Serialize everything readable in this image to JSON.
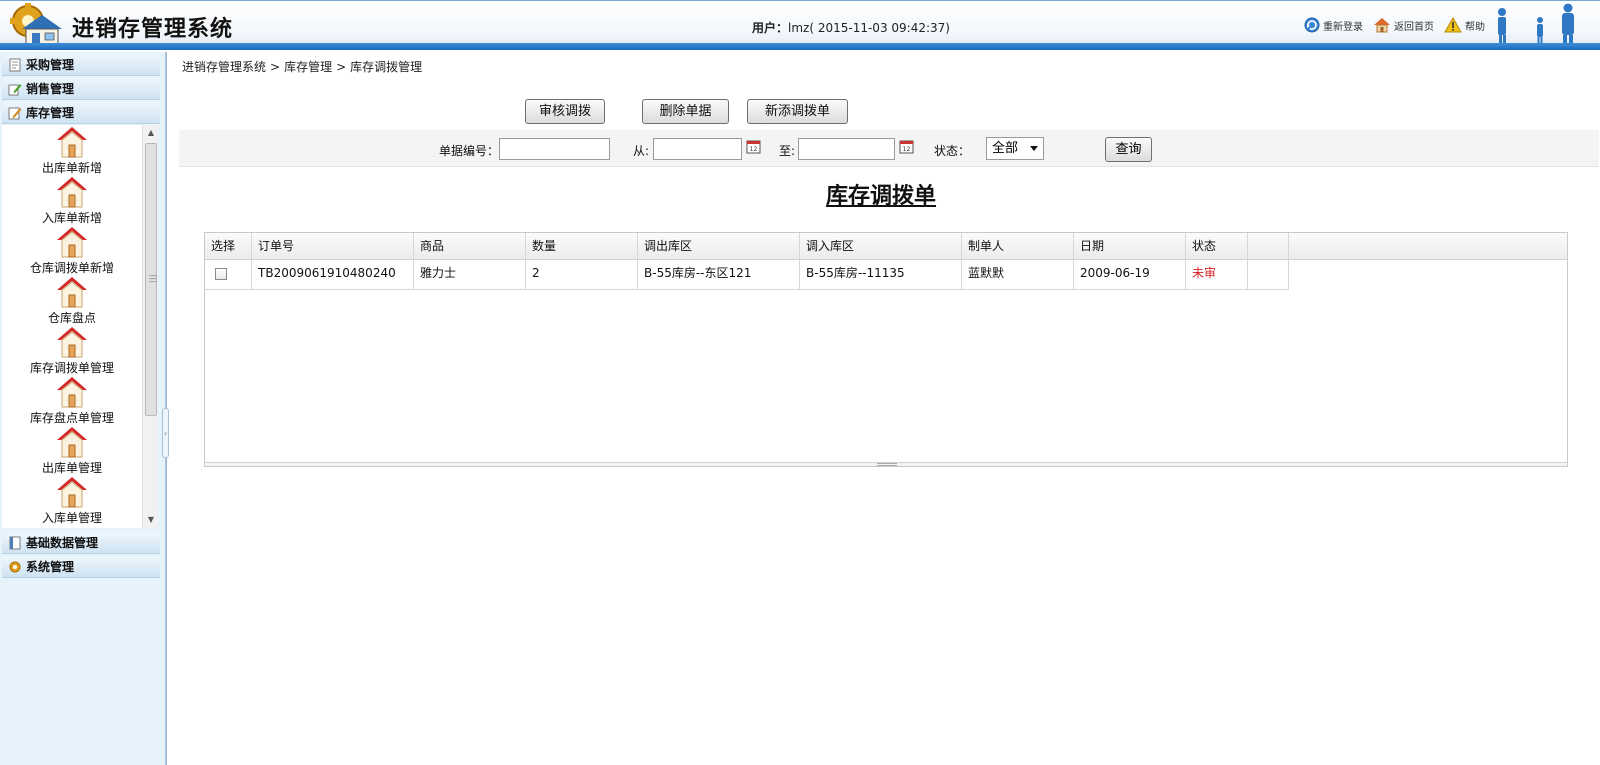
{
  "header": {
    "title": "进销存管理系统",
    "user_label": "用户：",
    "user_value": "lmz( 2015-11-03 09:42:37)",
    "links": [
      {
        "label": "重新登录",
        "icon": "refresh-icon"
      },
      {
        "label": "返回首页",
        "icon": "home-icon"
      },
      {
        "label": "帮助",
        "icon": "warning-icon"
      }
    ]
  },
  "sidebar": {
    "menus": [
      {
        "label": "采购管理",
        "icon": "document-icon"
      },
      {
        "label": "销售管理",
        "icon": "edit-icon"
      },
      {
        "label": "库存管理",
        "icon": "pencil-icon"
      },
      {
        "label": "基础数据管理",
        "icon": "book-icon"
      },
      {
        "label": "系统管理",
        "icon": "gear-icon"
      }
    ],
    "items": [
      {
        "label": "出库单新增",
        "icon": "house-icon"
      },
      {
        "label": "入库单新增",
        "icon": "house-icon"
      },
      {
        "label": "仓库调拨单新增",
        "icon": "house-icon"
      },
      {
        "label": "仓库盘点",
        "icon": "house-icon"
      },
      {
        "label": "库存调拨单管理",
        "icon": "house-icon"
      },
      {
        "label": "库存盘点单管理",
        "icon": "house-icon"
      },
      {
        "label": "出库单管理",
        "icon": "house-icon"
      },
      {
        "label": "入库单管理",
        "icon": "house-icon"
      }
    ]
  },
  "breadcrumb": {
    "items": [
      "进销存管理系统",
      "库存管理",
      "库存调拨管理"
    ],
    "separator": ">"
  },
  "toolbar": {
    "audit_label": "审核调拨",
    "delete_label": "删除单据",
    "add_label": "新添调拨单"
  },
  "search": {
    "doc_no_label": "单据编号：",
    "doc_no_value": "",
    "from_label": "从:",
    "from_value": "",
    "to_label": "至:",
    "to_value": "",
    "status_label": "状态：",
    "status_value": "全部",
    "query_label": "查询"
  },
  "page_title": "库存调拨单",
  "table": {
    "columns": [
      "选择",
      "订单号",
      "商品",
      "数量",
      "调出库区",
      "调入库区",
      "制单人",
      "日期",
      "状态"
    ],
    "rows": [
      {
        "order_no": "TB2009061910480240",
        "product": "雅力士",
        "qty": "2",
        "from_area": "B-55库房--东区121",
        "to_area": "B-55库房--11135",
        "creator": "蓝默默",
        "date": "2009-06-19",
        "status": "未审",
        "checked": false
      }
    ]
  },
  "colors": {
    "header_bar": "#1e6bbd",
    "sidebar_bg": "#e6f3fb",
    "status_unaudited": "#d42020"
  }
}
